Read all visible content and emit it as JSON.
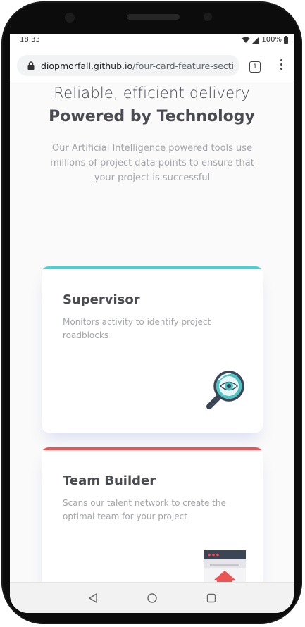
{
  "status_bar": {
    "time": "18:33",
    "battery": "100%"
  },
  "browser": {
    "url_domain": "diopmorfall.github.io",
    "url_path": " /four-card-feature-secti",
    "tab_count": "1"
  },
  "hero": {
    "subtitle": "Reliable, efficient delivery",
    "title": "Powered by Technology",
    "description": "Our Artificial Intelligence powered tools use millions of project data points to ensure that your project is successful"
  },
  "cards": [
    {
      "title": "Supervisor",
      "description": "Monitors activity to identify project roadblocks",
      "accent_color": "#44d3d2",
      "icon": "magnifier-eye-icon"
    },
    {
      "title": "Team Builder",
      "description": "Scans our talent network to create the optimal team for your project",
      "accent_color": "#ea5454",
      "icon": "team-builder-icon"
    }
  ],
  "nav_icons": [
    "back-icon",
    "home-icon",
    "recents-icon"
  ]
}
